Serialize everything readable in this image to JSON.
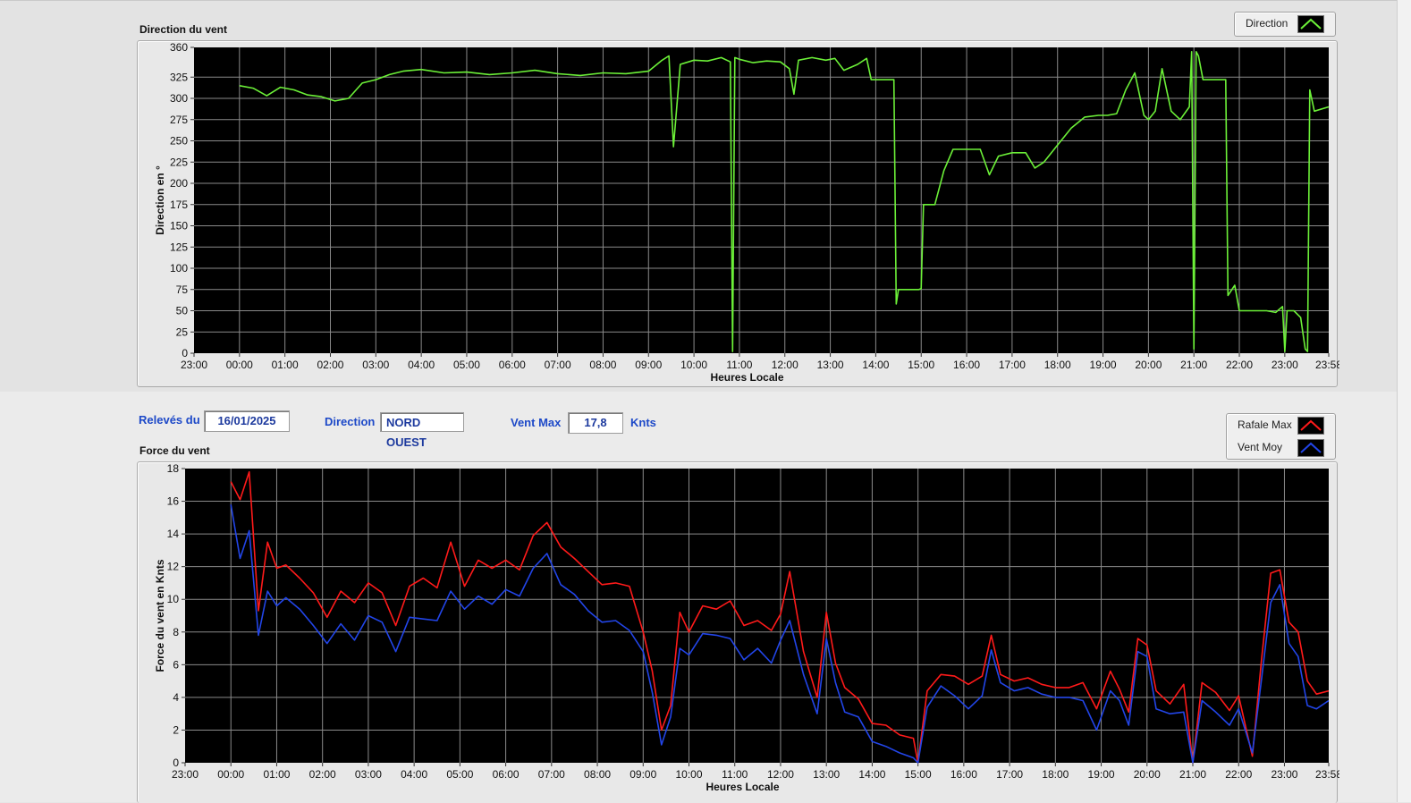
{
  "direction_panel": {
    "title": "Direction du vent",
    "legend_label": "Direction"
  },
  "force_panel": {
    "title": "Force du vent",
    "legend_labels": [
      "Rafale Max",
      "Vent Moy"
    ]
  },
  "info": {
    "date_label": "Relevés du",
    "date_value": "16/01/2025",
    "direction_label": "Direction",
    "direction_value": "NORD OUEST",
    "vent_max_label": "Vent Max",
    "vent_max_value": "17,8",
    "vent_max_unit": "Knts"
  },
  "colors": {
    "direction": "#6cf038",
    "rafale": "#ff1a1a",
    "vent_moy": "#2245e8",
    "plot_bg": "#000000",
    "grid": "#8a8a8a"
  },
  "chart_data": [
    {
      "type": "line",
      "title": "Direction du vent",
      "xlabel": "Heures Locale",
      "ylabel": "Direction en °",
      "xlim": [
        -1,
        23.967
      ],
      "ylim": [
        0,
        360
      ],
      "x_ticks": [
        "23:00",
        "00:00",
        "01:00",
        "02:00",
        "03:00",
        "04:00",
        "05:00",
        "06:00",
        "07:00",
        "08:00",
        "09:00",
        "10:00",
        "11:00",
        "12:00",
        "13:00",
        "14:00",
        "15:00",
        "16:00",
        "17:00",
        "18:00",
        "19:00",
        "20:00",
        "21:00",
        "22:00",
        "23:00",
        "23:58"
      ],
      "y_ticks": [
        0,
        25,
        50,
        75,
        100,
        125,
        150,
        175,
        200,
        225,
        250,
        275,
        300,
        325,
        360
      ],
      "grid": true,
      "series": [
        {
          "name": "Direction",
          "x": [
            0,
            0.3,
            0.6,
            0.9,
            1.2,
            1.5,
            1.8,
            2.1,
            2.4,
            2.7,
            3.0,
            3.3,
            3.6,
            4.0,
            4.5,
            5.0,
            5.5,
            6.0,
            6.5,
            7.0,
            7.5,
            8.0,
            8.5,
            9.0,
            9.3,
            9.45,
            9.55,
            9.7,
            10.0,
            10.3,
            10.6,
            10.8,
            10.85,
            10.9,
            11.0,
            11.3,
            11.6,
            11.9,
            12.1,
            12.2,
            12.3,
            12.6,
            12.9,
            13.1,
            13.3,
            13.6,
            13.8,
            13.9,
            14.0,
            14.1,
            14.4,
            14.45,
            14.5,
            14.6,
            14.95,
            15.0,
            15.05,
            15.3,
            15.5,
            15.7,
            16.0,
            16.3,
            16.5,
            16.7,
            17.0,
            17.3,
            17.5,
            17.7,
            18.0,
            18.3,
            18.6,
            18.9,
            19.1,
            19.3,
            19.5,
            19.7,
            19.9,
            20.0,
            20.15,
            20.3,
            20.5,
            20.7,
            20.9,
            20.95,
            21.0,
            21.05,
            21.1,
            21.2,
            21.4,
            21.7,
            21.75,
            21.9,
            22.0,
            22.3,
            22.6,
            22.8,
            22.95,
            23.0,
            23.05,
            23.2,
            23.35,
            23.45,
            23.5,
            23.55,
            23.65,
            23.967
          ],
          "values": [
            315,
            312,
            303,
            313,
            310,
            304,
            302,
            297,
            300,
            318,
            322,
            328,
            332,
            334,
            330,
            331,
            328,
            330,
            333,
            329,
            327,
            330,
            329,
            332,
            345,
            350,
            243,
            340,
            345,
            344,
            348,
            343,
            2,
            348,
            346,
            342,
            344,
            343,
            335,
            305,
            345,
            348,
            345,
            347,
            333,
            340,
            347,
            322,
            322,
            322,
            322,
            58,
            75,
            75,
            75,
            76,
            175,
            175,
            215,
            240,
            240,
            240,
            210,
            232,
            236,
            236,
            218,
            225,
            245,
            265,
            278,
            280,
            280,
            282,
            310,
            330,
            280,
            275,
            285,
            335,
            285,
            275,
            290,
            355,
            5,
            355,
            350,
            322,
            322,
            322,
            68,
            80,
            50,
            50,
            50,
            48,
            55,
            2,
            50,
            50,
            42,
            5,
            2,
            310,
            285,
            290
          ]
        }
      ]
    },
    {
      "type": "line",
      "title": "Force du vent",
      "xlabel": "Heures Locale",
      "ylabel": "Force du vent en Knts",
      "xlim": [
        -1,
        23.967
      ],
      "ylim": [
        0,
        18
      ],
      "x_ticks": [
        "23:00",
        "00:00",
        "01:00",
        "02:00",
        "03:00",
        "04:00",
        "05:00",
        "06:00",
        "07:00",
        "08:00",
        "09:00",
        "10:00",
        "11:00",
        "12:00",
        "13:00",
        "14:00",
        "15:00",
        "16:00",
        "17:00",
        "18:00",
        "19:00",
        "20:00",
        "21:00",
        "22:00",
        "23:00",
        "23:58"
      ],
      "y_ticks": [
        0,
        2,
        4,
        6,
        8,
        10,
        12,
        14,
        16,
        18
      ],
      "grid": true,
      "series": [
        {
          "name": "Rafale Max",
          "x": [
            0,
            0.2,
            0.4,
            0.6,
            0.8,
            1.0,
            1.2,
            1.5,
            1.8,
            2.1,
            2.4,
            2.7,
            3.0,
            3.3,
            3.6,
            3.9,
            4.2,
            4.5,
            4.8,
            5.1,
            5.4,
            5.7,
            6.0,
            6.3,
            6.6,
            6.9,
            7.2,
            7.5,
            7.8,
            8.1,
            8.4,
            8.7,
            9.0,
            9.2,
            9.4,
            9.6,
            9.8,
            10.0,
            10.3,
            10.6,
            10.9,
            11.2,
            11.5,
            11.8,
            12.0,
            12.2,
            12.5,
            12.8,
            13.0,
            13.2,
            13.4,
            13.7,
            14.0,
            14.3,
            14.6,
            14.9,
            15.0,
            15.2,
            15.5,
            15.8,
            16.1,
            16.4,
            16.6,
            16.8,
            17.1,
            17.4,
            17.7,
            18.0,
            18.3,
            18.6,
            18.9,
            19.2,
            19.4,
            19.6,
            19.8,
            20.0,
            20.2,
            20.5,
            20.8,
            21.0,
            21.2,
            21.5,
            21.8,
            22.0,
            22.3,
            22.5,
            22.7,
            22.9,
            23.1,
            23.3,
            23.5,
            23.7,
            23.967
          ],
          "values": [
            17.2,
            16.1,
            17.8,
            9.3,
            13.5,
            11.9,
            12.1,
            11.3,
            10.4,
            8.9,
            10.5,
            9.8,
            11.0,
            10.4,
            8.4,
            10.8,
            11.3,
            10.7,
            13.5,
            10.8,
            12.4,
            11.9,
            12.4,
            11.8,
            13.9,
            14.7,
            13.2,
            12.5,
            11.7,
            10.9,
            11.0,
            10.8,
            8.0,
            5.6,
            2.0,
            3.5,
            9.2,
            8.0,
            9.6,
            9.4,
            9.9,
            8.4,
            8.7,
            8.1,
            9.1,
            11.7,
            6.8,
            4.0,
            9.2,
            6.1,
            4.6,
            3.9,
            2.4,
            2.3,
            1.7,
            1.5,
            0,
            4.4,
            5.4,
            5.3,
            4.8,
            5.3,
            7.8,
            5.4,
            5.0,
            5.2,
            4.8,
            4.6,
            4.6,
            4.9,
            3.3,
            5.6,
            4.5,
            3.1,
            7.6,
            7.2,
            4.4,
            3.6,
            4.8,
            0,
            4.9,
            4.3,
            3.2,
            4.1,
            0.4,
            6.3,
            11.6,
            11.8,
            8.6,
            8.0,
            5.0,
            4.2,
            4.4
          ]
        },
        {
          "name": "Vent Moy",
          "x": [
            0,
            0.2,
            0.4,
            0.6,
            0.8,
            1.0,
            1.2,
            1.5,
            1.8,
            2.1,
            2.4,
            2.7,
            3.0,
            3.3,
            3.6,
            3.9,
            4.2,
            4.5,
            4.8,
            5.1,
            5.4,
            5.7,
            6.0,
            6.3,
            6.6,
            6.9,
            7.2,
            7.5,
            7.8,
            8.1,
            8.4,
            8.7,
            9.0,
            9.2,
            9.4,
            9.6,
            9.8,
            10.0,
            10.3,
            10.6,
            10.9,
            11.2,
            11.5,
            11.8,
            12.0,
            12.2,
            12.5,
            12.8,
            13.0,
            13.2,
            13.4,
            13.7,
            14.0,
            14.3,
            14.6,
            14.9,
            15.0,
            15.2,
            15.5,
            15.8,
            16.1,
            16.4,
            16.6,
            16.8,
            17.1,
            17.4,
            17.7,
            18.0,
            18.3,
            18.6,
            18.9,
            19.2,
            19.4,
            19.6,
            19.8,
            20.0,
            20.2,
            20.5,
            20.8,
            21.0,
            21.2,
            21.5,
            21.8,
            22.0,
            22.3,
            22.5,
            22.7,
            22.9,
            23.1,
            23.3,
            23.5,
            23.7,
            23.967
          ],
          "values": [
            15.8,
            12.5,
            14.2,
            7.8,
            10.5,
            9.6,
            10.1,
            9.4,
            8.4,
            7.3,
            8.5,
            7.5,
            9.0,
            8.6,
            6.8,
            8.9,
            8.8,
            8.7,
            10.5,
            9.4,
            10.2,
            9.7,
            10.6,
            10.2,
            11.9,
            12.8,
            10.9,
            10.3,
            9.3,
            8.6,
            8.7,
            8.1,
            6.8,
            4.3,
            1.1,
            2.8,
            7.0,
            6.6,
            7.9,
            7.8,
            7.6,
            6.3,
            7.0,
            6.1,
            7.5,
            8.7,
            5.4,
            3.0,
            7.6,
            4.9,
            3.1,
            2.8,
            1.3,
            1.0,
            0.6,
            0.3,
            0,
            3.4,
            4.7,
            4.1,
            3.3,
            4.1,
            6.9,
            4.9,
            4.4,
            4.6,
            4.2,
            4.0,
            4.0,
            3.8,
            2.0,
            4.4,
            3.8,
            2.3,
            6.8,
            6.5,
            3.3,
            3.0,
            3.1,
            0,
            3.8,
            3.1,
            2.3,
            3.3,
            0.6,
            5.1,
            9.8,
            10.9,
            7.3,
            6.5,
            3.5,
            3.3,
            3.8
          ]
        }
      ]
    }
  ]
}
